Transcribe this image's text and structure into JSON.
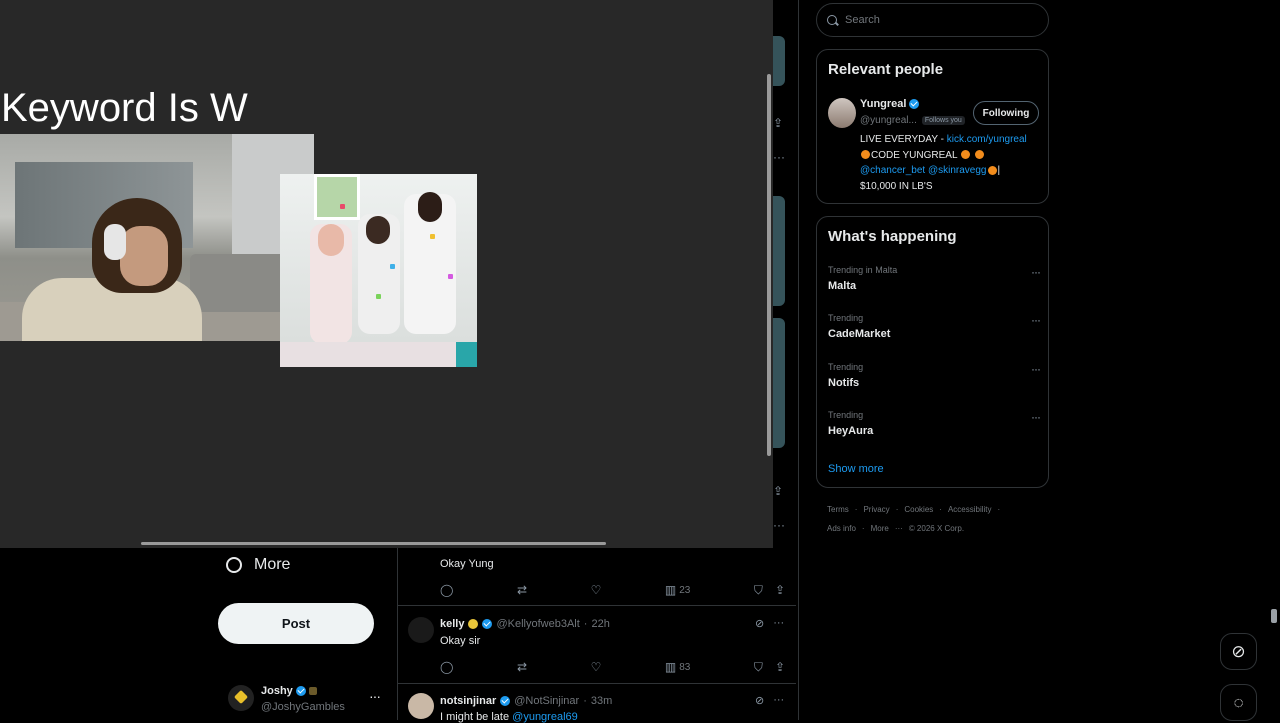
{
  "overlay": {
    "keyword_text": "Keyword Is W"
  },
  "left_nav": {
    "more_label": "More",
    "post_label": "Post",
    "account": {
      "name": "Joshy",
      "handle": "@JoshyGambles"
    }
  },
  "feed": {
    "partial_tweet": {
      "text": "Okay Yung",
      "views": "23"
    },
    "tweets": [
      {
        "name": "kelly",
        "handle": "@Kellyofweb3Alt",
        "time": "22h",
        "text": "Okay sir",
        "views": "83"
      },
      {
        "name": "notsinjinar",
        "handle": "@NotSinjinar",
        "time": "33m",
        "text": "I might be late",
        "mention": "@yungreal69"
      }
    ]
  },
  "search": {
    "placeholder": "Search"
  },
  "relevant_people": {
    "title": "Relevant people",
    "person": {
      "name": "Yungreal",
      "handle": "@yungreal...",
      "follows_you": "Follows you",
      "button": "Following",
      "bio_prefix": "LIVE EVERYDAY - ",
      "bio_link": "kick.com/yungreal",
      "bio_code": "CODE YUNGREAL",
      "bio_mention1": "@chancer_bet",
      "bio_mention2": "@skinravegg",
      "bio_prize": "$10,000 IN LB'S"
    }
  },
  "whats_happening": {
    "title": "What's happening",
    "trends": [
      {
        "context": "Trending in Malta",
        "title": "Malta"
      },
      {
        "context": "Trending",
        "title": "CadeMarket"
      },
      {
        "context": "Trending",
        "title": "Notifs"
      },
      {
        "context": "Trending",
        "title": "HeyAura"
      }
    ],
    "show_more": "Show more"
  },
  "footer": {
    "row1": [
      "Terms",
      "Privacy",
      "Cookies",
      "Accessibility"
    ],
    "row2": [
      "Ads info",
      "More",
      "© 2026 X Corp."
    ]
  },
  "icons": {
    "grok": "grok-icon",
    "messages": "messages-icon"
  },
  "colors": {
    "accent": "#1d9bf0",
    "background": "#000000",
    "overlay_background": "#282828"
  }
}
